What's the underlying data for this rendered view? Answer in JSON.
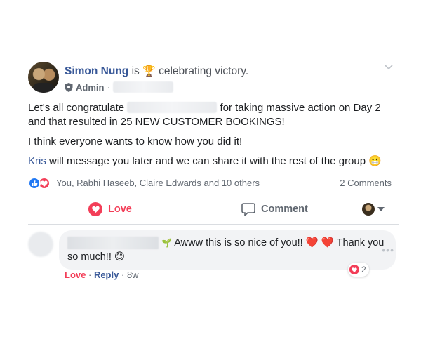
{
  "post": {
    "author": "Simon Nung",
    "is_text": "is",
    "activity_icon": "trophy-icon",
    "activity": "celebrating victory.",
    "role": "Admin",
    "role_sep": "·",
    "body": {
      "p1_before": "Let's all congratulate",
      "p1_after": "for taking massive action on Day 2 and that resulted in 25 NEW CUSTOMER BOOKINGS!",
      "p2": "I think everyone wants to know how you did it!",
      "p3_mention": "Kris",
      "p3_rest": "will message you later and we can share it with the rest of the group",
      "p3_emoji": "😬"
    },
    "reactions_text": "You, Rabhi Haseeb, Claire Edwards and 10 others",
    "comments_count": "2 Comments"
  },
  "actions": {
    "love_label": "Love",
    "comment_label": "Comment"
  },
  "comment": {
    "text_start": "Awww this is so nice of you!!",
    "hearts": "❤️ ❤️",
    "text_end": "Thank you so much!!",
    "emoji": "😊",
    "reaction_count": "2",
    "more": "•••",
    "meta_love": "Love",
    "meta_sep1": "·",
    "meta_reply": "Reply",
    "meta_sep2": "·",
    "meta_time": "8w"
  },
  "colors": {
    "link_blue": "#385898",
    "love_red": "#f33e58",
    "like_blue": "#2078f4",
    "muted_text": "#606770",
    "bubble_bg": "#f2f3f5"
  }
}
